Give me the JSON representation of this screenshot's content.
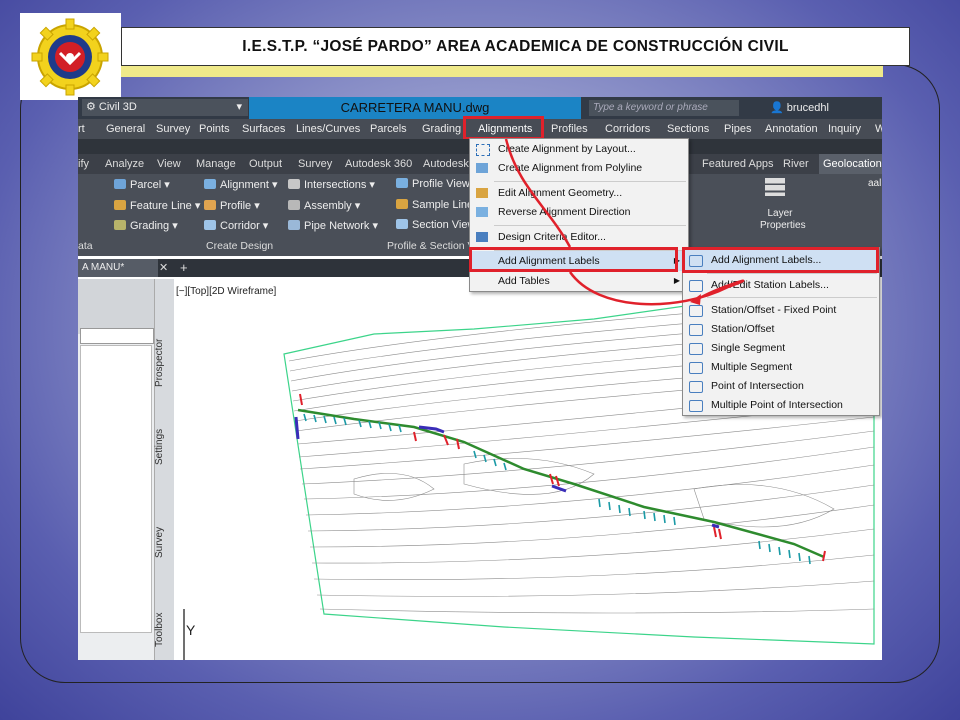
{
  "header": {
    "title": "I.E.S.T.P. “JOSÉ PARDO” AREA ACADEMICA DE CONSTRUCCIÓN CIVIL"
  },
  "app": {
    "workspace": "Civil 3D",
    "document_title": "CARRETERA MANU.dwg",
    "search_placeholder": "Type a keyword or phrase",
    "user": "brucedhl"
  },
  "menubar": {
    "items": [
      "rt",
      "General",
      "Survey",
      "Points",
      "Surfaces",
      "Lines/Curves",
      "Parcels",
      "Grading",
      "Alignments",
      "Profiles",
      "Corridors",
      "Sections",
      "Pipes",
      "Annotation",
      "Inquiry",
      "W"
    ]
  },
  "ribbon_tabs": {
    "items": [
      "ify",
      "Analyze",
      "View",
      "Manage",
      "Output",
      "Survey",
      "Autodesk 360",
      "Autodesk",
      "Featured Apps",
      "River",
      "Geolocation"
    ]
  },
  "ribbon": {
    "create_design": [
      "Parcel",
      "Feature Line",
      "Grading",
      "Alignment",
      "Profile",
      "Corridor",
      "Intersections",
      "Assembly",
      "Pipe Network"
    ],
    "profile_section": [
      "Profile View",
      "Sample Lines",
      "Section View"
    ],
    "layer_properties": "Layer Properties",
    "panel_data": "ata",
    "panel_create_design": "Create Design",
    "panel_profile_section": "Profile & Section V",
    "layer_text": "aal"
  },
  "doc_tab": "A MANU*",
  "viewport_label": "[−][Top][2D Wireframe]",
  "palette_tabs": [
    "Prospector",
    "Settings",
    "Survey",
    "Toolbox"
  ],
  "axis_label": "Y",
  "alignments_menu": {
    "items": [
      "Create Alignment by Layout...",
      "Create Alignment from Polyline",
      "Edit Alignment Geometry...",
      "Reverse Alignment Direction",
      "Design Criteria Editor...",
      "Add Alignment Labels",
      "Add Tables"
    ]
  },
  "labels_submenu": {
    "items": [
      "Add Alignment Labels...",
      "Add/Edit Station Labels...",
      "Station/Offset - Fixed Point",
      "Station/Offset",
      "Single Segment",
      "Multiple Segment",
      "Point of Intersection",
      "Multiple Point of Intersection"
    ]
  },
  "colors": {
    "highlight": "#e0212b",
    "doc_title_bg": "#1b84c5",
    "alignment_line": "#2e8b2e",
    "contour_lines": "#8c8c8c",
    "boundary": "#3cd48a"
  }
}
